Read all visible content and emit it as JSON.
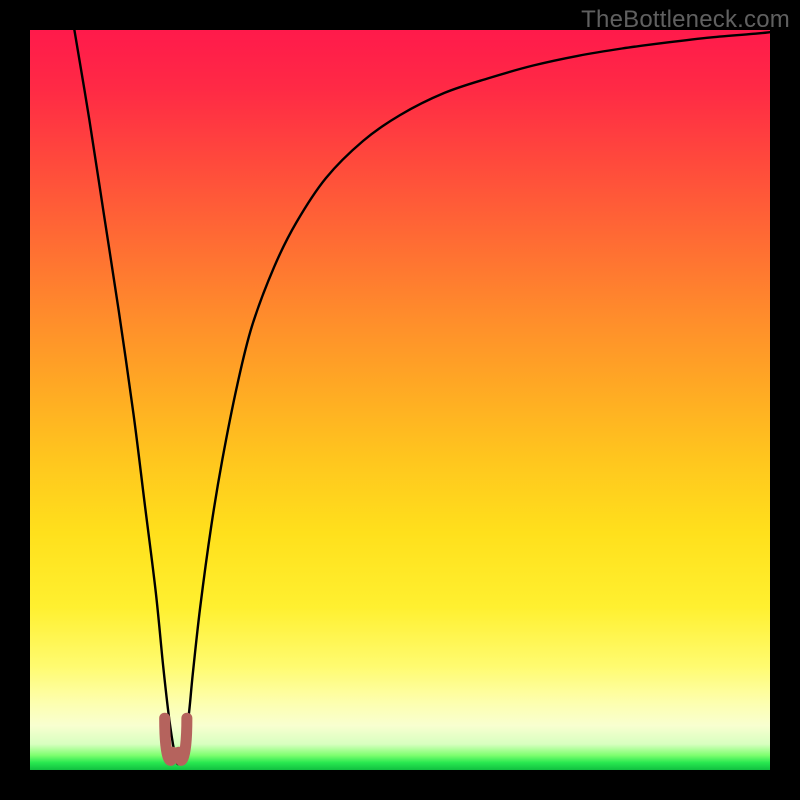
{
  "watermark": {
    "text": "TheBottleneck.com"
  },
  "colors": {
    "frame": "#000000",
    "gradient_top": "#ff1a4b",
    "gradient_mid": "#ffe01c",
    "gradient_bottom": "#10c040",
    "curve": "#000000",
    "marker": "#b5635d"
  },
  "chart_data": {
    "type": "line",
    "title": "",
    "xlabel": "",
    "ylabel": "",
    "xlim": [
      0,
      100
    ],
    "ylim": [
      0,
      100
    ],
    "grid": false,
    "legend": false,
    "series": [
      {
        "name": "bottleneck-curve",
        "x": [
          6,
          8,
          10,
          12,
          14,
          15.5,
          17,
          18,
          18.8,
          19.5,
          20,
          20.6,
          21.4,
          22,
          23,
          24.5,
          26,
          28,
          30,
          33,
          36,
          40,
          45,
          50,
          56,
          62,
          68,
          74,
          80,
          86,
          92,
          98,
          100
        ],
        "y": [
          100,
          88,
          75,
          62,
          48,
          36,
          24,
          14,
          7,
          2.5,
          0.8,
          2.5,
          7,
          13,
          22,
          33,
          42,
          52,
          60,
          68,
          74,
          80,
          85,
          88.5,
          91.5,
          93.5,
          95.2,
          96.5,
          97.5,
          98.3,
          99,
          99.5,
          99.7
        ]
      }
    ],
    "annotations": [
      {
        "name": "min-marker",
        "x_range": [
          18.2,
          21.2
        ],
        "y_range": [
          0.5,
          7
        ],
        "shape": "u"
      }
    ]
  }
}
